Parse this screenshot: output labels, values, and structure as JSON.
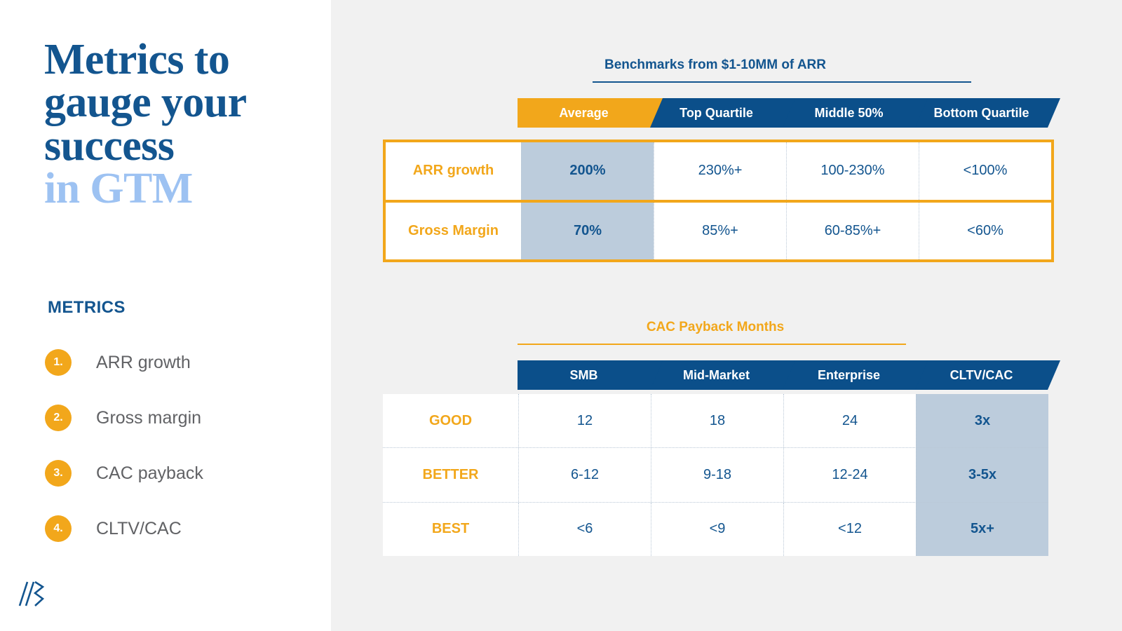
{
  "colors": {
    "brand_blue": "#13558f",
    "light_blue": "#9dc2f2",
    "orange": "#f2a71b",
    "highlight": "#bcccdc",
    "panel_bg": "#f1f1f1",
    "text_gray": "#616265"
  },
  "title": {
    "line1": "Metrics to",
    "line2": "gauge your",
    "line3": "success",
    "line4_accent": "in GTM"
  },
  "sidebar": {
    "heading": "METRICS",
    "items": [
      {
        "number": "1.",
        "label": "ARR growth"
      },
      {
        "number": "2.",
        "label": "Gross margin"
      },
      {
        "number": "3.",
        "label": "CAC payback"
      },
      {
        "number": "4.",
        "label": "CLTV/CAC"
      }
    ]
  },
  "logo": {
    "name": "company-logo-mark"
  },
  "tables": [
    {
      "id": "benchmarks",
      "title": "Benchmarks from $1-10MM of ARR",
      "title_color": "#13558f",
      "rule_color": "#13558f",
      "columns": [
        {
          "label": "Average",
          "bg": "#f2a71b",
          "highlight": true
        },
        {
          "label": "Top Quartile",
          "bg": "#0b4f8a",
          "highlight": false
        },
        {
          "label": "Middle 50%",
          "bg": "#0b4f8a",
          "highlight": false
        },
        {
          "label": "Bottom Quartile",
          "bg": "#0b4f8a",
          "highlight": false
        }
      ],
      "rows": [
        {
          "label": "ARR growth",
          "values": [
            "200%",
            "230%+",
            "100-230%",
            "<100%"
          ]
        },
        {
          "label": "Gross Margin",
          "values": [
            "70%",
            "85%+",
            "60-85%+",
            "<60%"
          ]
        }
      ]
    },
    {
      "id": "cac-payback",
      "title": "CAC Payback Months",
      "title_color": "#f2a71b",
      "rule_color": "#f2a71b",
      "columns": [
        {
          "label": "SMB",
          "bg": "#0b4f8a",
          "highlight": false
        },
        {
          "label": "Mid-Market",
          "bg": "#0b4f8a",
          "highlight": false
        },
        {
          "label": "Enterprise",
          "bg": "#0b4f8a",
          "highlight": false
        },
        {
          "label": "CLTV/CAC",
          "bg": "#0b4f8a",
          "highlight": true
        }
      ],
      "rows": [
        {
          "label": "GOOD",
          "values": [
            "12",
            "18",
            "24",
            "3x"
          ]
        },
        {
          "label": "BETTER",
          "values": [
            "6-12",
            "9-18",
            "12-24",
            "3-5x"
          ]
        },
        {
          "label": "BEST",
          "values": [
            "<6",
            "<9",
            "<12",
            "5x+"
          ]
        }
      ]
    }
  ]
}
